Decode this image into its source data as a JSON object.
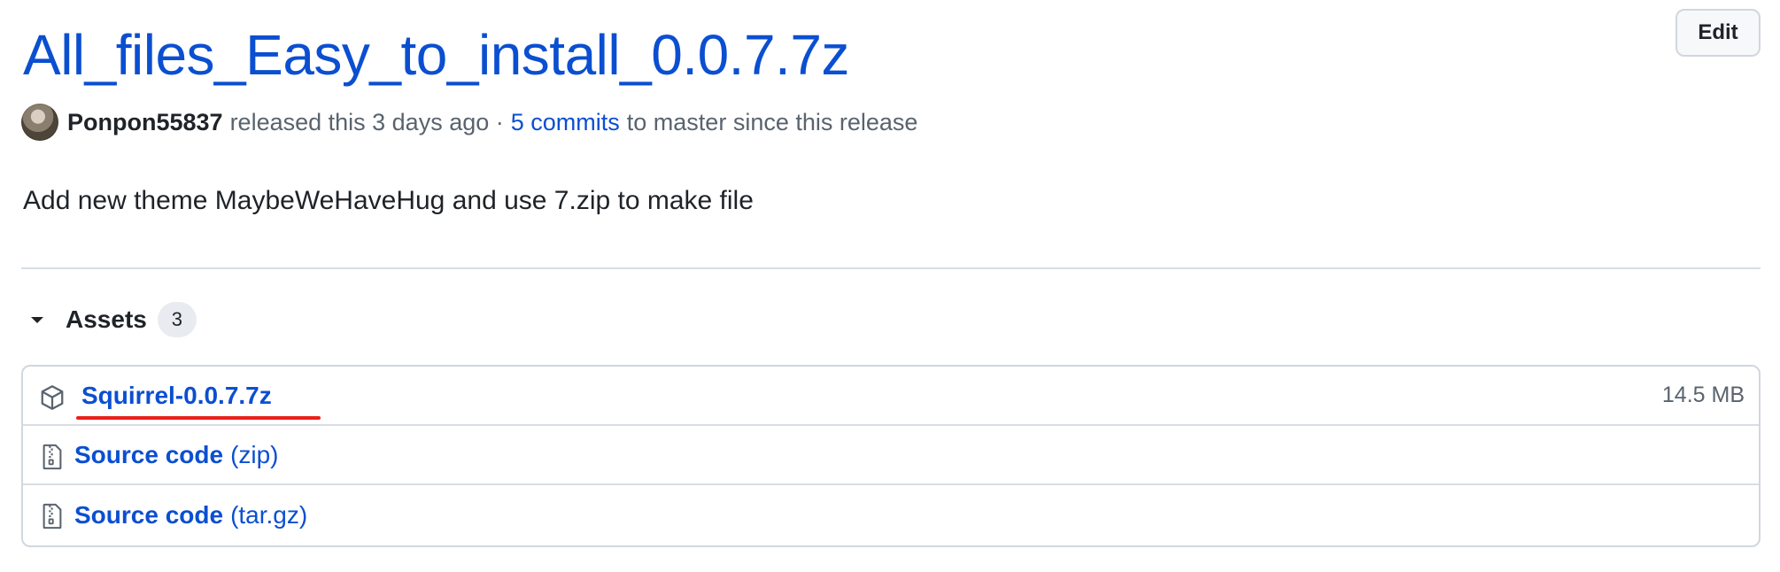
{
  "release": {
    "title": "All_files_Easy_to_install_0.0.7.7z",
    "edit_label": "Edit",
    "author": "Ponpon55837",
    "released_text": "released this 3 days ago ·",
    "commits_link": "5 commits",
    "commits_suffix": "to master since this release",
    "body": "Add new theme MaybeWeHaveHug and use 7.zip to make file"
  },
  "assets": {
    "label": "Assets",
    "count": "3",
    "items": [
      {
        "name": "Squirrel-0.0.7.7z",
        "suffix": "",
        "size": "14.5 MB",
        "icon": "package-icon"
      },
      {
        "name": "Source code",
        "suffix": "(zip)",
        "size": "",
        "icon": "file-zip-icon"
      },
      {
        "name": "Source code",
        "suffix": "(tar.gz)",
        "size": "",
        "icon": "file-zip-icon"
      }
    ]
  },
  "annotation": {
    "underline_color": "#e8221b"
  },
  "colors": {
    "link": "#0b4fd1",
    "text": "#1f2328",
    "muted": "#59636e"
  }
}
